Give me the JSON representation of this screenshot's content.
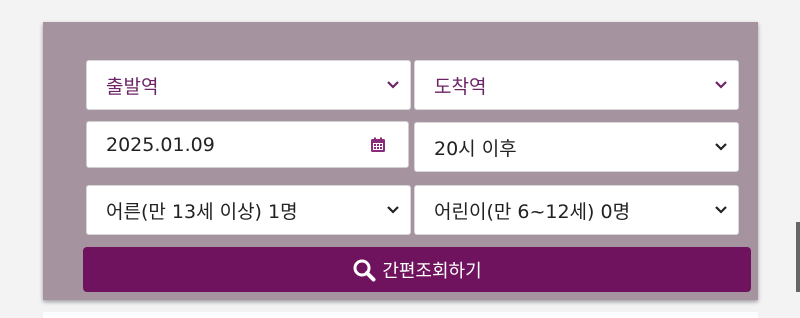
{
  "form": {
    "departure": {
      "value": "출발역",
      "icon": "chevron-down-icon"
    },
    "arrival": {
      "value": "도착역",
      "icon": "chevron-down-icon"
    },
    "date": {
      "value": "2025.01.09",
      "icon": "calendar-icon"
    },
    "time": {
      "value": "20시 이후",
      "icon": "chevron-down-icon"
    },
    "adults": {
      "value": "어른(만 13세 이상) 1명",
      "icon": "chevron-down-icon"
    },
    "children": {
      "value": "어린이(만 6~12세) 0명",
      "icon": "chevron-down-icon"
    },
    "search_button": {
      "label": "간편조회하기",
      "icon": "search-icon"
    }
  },
  "colors": {
    "panel": "#a5939f",
    "accent": "#70135e",
    "placeholder_text": "#6d2466"
  }
}
